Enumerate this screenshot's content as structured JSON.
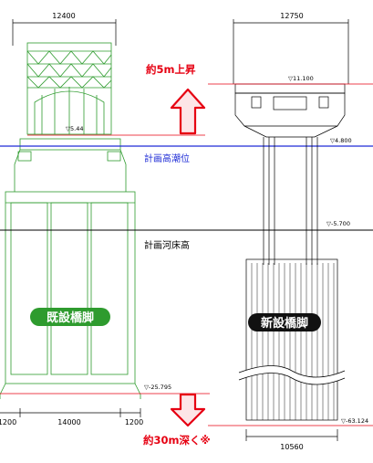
{
  "dimensions": {
    "old_width": "12400",
    "new_width": "12750",
    "old_base_left": "1200",
    "old_base_center": "14000",
    "old_base_right": "1200",
    "new_base": "10560"
  },
  "levels": {
    "old_deck": "▽5.44",
    "new_deck": "▽11.100",
    "high_tide": "▽4.800",
    "riverbed": "▽-5.700",
    "old_footing": "▽-25.795",
    "new_footing": "▽-63.124"
  },
  "lines": {
    "high_tide": "計画高潮位",
    "riverbed": "計画河床高"
  },
  "annotations": {
    "rise": "約5m上昇",
    "deeper": "約30m深く※"
  },
  "labels": {
    "old_pier": "既設橋脚",
    "new_pier": "新設橋脚"
  },
  "colors": {
    "green": "#2e9b2e",
    "red": "#e60012",
    "blue": "#1d2bd6"
  }
}
